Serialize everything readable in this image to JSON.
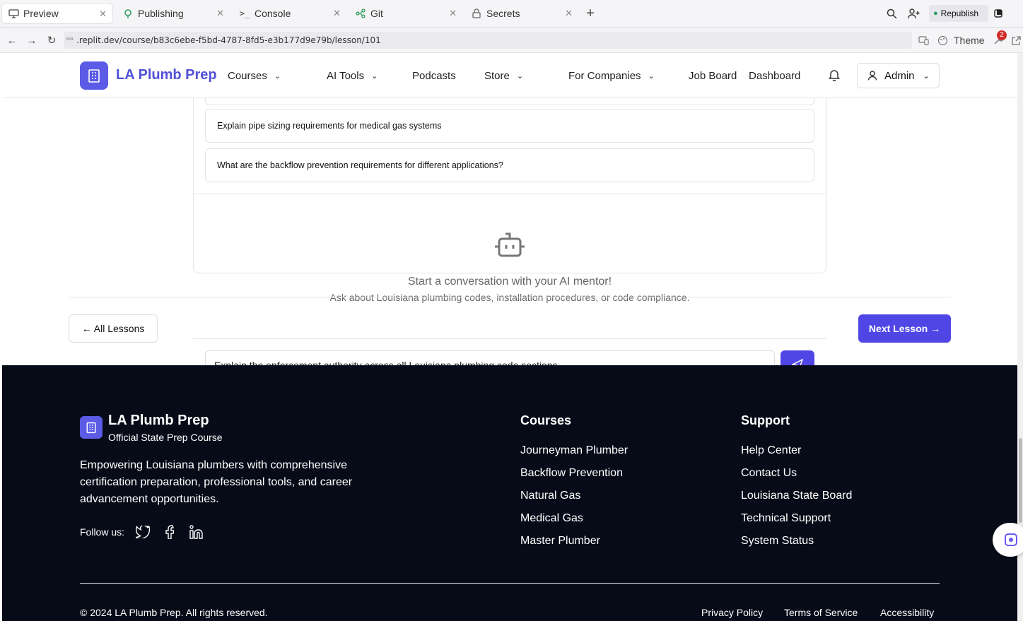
{
  "browser": {
    "tabs": [
      {
        "label": "Preview",
        "icon": "monitor-icon"
      },
      {
        "label": "Publishing",
        "icon": "publish-icon"
      },
      {
        "label": "Console",
        "icon": "terminal-icon"
      },
      {
        "label": "Git",
        "icon": "git-icon"
      },
      {
        "label": "Secrets",
        "icon": "lock-icon"
      }
    ],
    "republish_label": "Republish",
    "url": ".replit.dev/course/b83c6ebe-f5bd-4787-8fd5-e3b177d9e79b/lesson/101",
    "theme_label": "Theme",
    "badge_count": "2"
  },
  "header": {
    "brand": "LA Plumb Prep",
    "nav": [
      "Courses",
      "AI Tools",
      "Podcasts",
      "Store",
      "For Companies",
      "Job Board",
      "Dashboard"
    ],
    "admin_label": "Admin"
  },
  "chat": {
    "suggestions": [
      "Explain pipe sizing requirements for medical gas systems",
      "What are the backflow prevention requirements for different applications?"
    ],
    "empty_title": "Start a conversation with your AI mentor!",
    "empty_subtitle": "Ask about Louisiana plumbing codes, installation procedures, or code compliance.",
    "input_value": "Explain the enforcement authority across all Louisiana plumbing code sections"
  },
  "lesson_nav": {
    "back_label": "← All Lessons",
    "next_label": "Next Lesson →"
  },
  "footer": {
    "brand": "LA Plumb Prep",
    "tagline": "Official State Prep Course",
    "description": "Empowering Louisiana plumbers with comprehensive certification preparation, professional tools, and career advancement opportunities.",
    "follow_label": "Follow us:",
    "courses_heading": "Courses",
    "courses": [
      "Journeyman Plumber",
      "Backflow Prevention",
      "Natural Gas",
      "Medical Gas",
      "Master Plumber"
    ],
    "support_heading": "Support",
    "support": [
      "Help Center",
      "Contact Us",
      "Louisiana State Board",
      "Technical Support",
      "System Status"
    ],
    "copyright": "© 2024 LA Plumb Prep. All rights reserved.",
    "bottom_links": [
      "Privacy Policy",
      "Terms of Service",
      "Accessibility"
    ]
  },
  "colors": {
    "accent": "#4f46e5",
    "footer_bg": "#070b18",
    "brand_text": "#5050d8"
  }
}
